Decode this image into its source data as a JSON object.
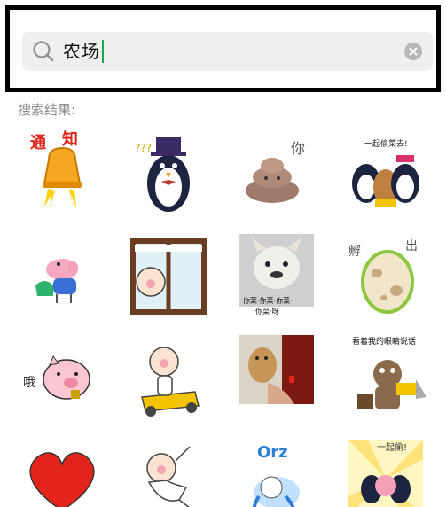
{
  "search": {
    "query": "农场",
    "icon": "search-icon",
    "clear_icon": "clear-icon"
  },
  "results": {
    "label": "搜索结果:",
    "stickers": [
      {
        "name": "sticker-bell-notice",
        "text": "通知"
      },
      {
        "name": "sticker-penguin-magician",
        "text": ""
      },
      {
        "name": "sticker-poop-ni",
        "text": "你"
      },
      {
        "name": "sticker-group-together",
        "text": "一起偷菜去!"
      },
      {
        "name": "sticker-peppa-pig-dinosaur",
        "text": ""
      },
      {
        "name": "sticker-pig-at-window",
        "text": ""
      },
      {
        "name": "sticker-bulldog-photo",
        "text": "你菜·你菜·你菜·你菜·呀"
      },
      {
        "name": "sticker-egg-hatching",
        "text": "孵出"
      },
      {
        "name": "sticker-pig-oh",
        "text": "哦"
      },
      {
        "name": "sticker-pig-on-mower",
        "text": ""
      },
      {
        "name": "sticker-cat-photo",
        "text": ""
      },
      {
        "name": "sticker-chainsaw-bear",
        "text": "看着我的眼睛说话"
      },
      {
        "name": "sticker-red-heart",
        "text": ""
      },
      {
        "name": "sticker-pig-dancing",
        "text": ""
      },
      {
        "name": "sticker-orz-girl",
        "text": "Orz"
      },
      {
        "name": "sticker-group-hug",
        "text": "一起偷!"
      }
    ]
  },
  "colors": {
    "search_bg": "#efefef",
    "caret": "#1fa64a",
    "label": "#8a8a8a",
    "frame": "#000000"
  }
}
